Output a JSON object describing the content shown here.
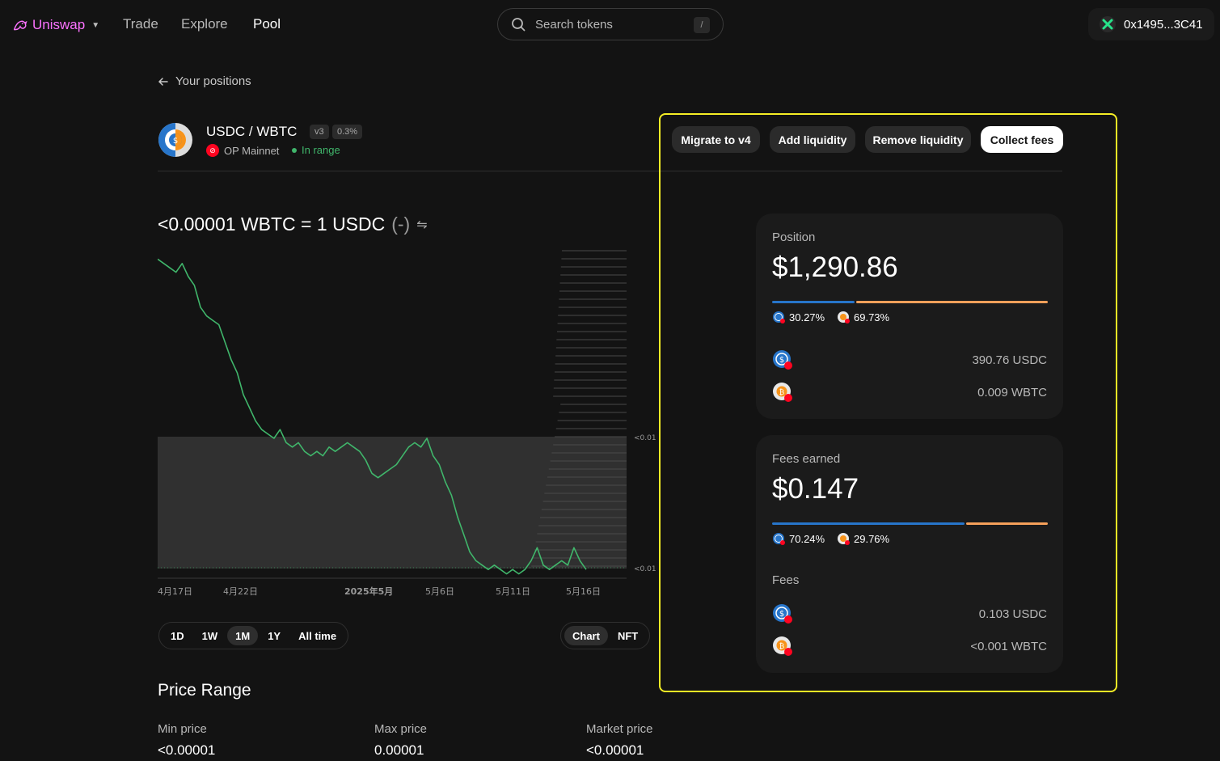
{
  "nav": {
    "brand": "Uniswap",
    "links": [
      "Trade",
      "Explore",
      "Pool"
    ],
    "search_placeholder": "Search tokens",
    "search_shortcut": "/",
    "wallet": "0x1495...3C41"
  },
  "header": {
    "back_label": "Your positions",
    "pair": "USDC / WBTC",
    "version": "v3",
    "fee": "0.3%",
    "network": "OP Mainnet",
    "status": "In range"
  },
  "actions": {
    "migrate": "Migrate to v4",
    "add": "Add liquidity",
    "remove": "Remove liquidity",
    "collect": "Collect fees"
  },
  "price": {
    "quote": "<0.00001 WBTC = 1 USDC",
    "change": "(-)"
  },
  "chart_data": {
    "type": "line",
    "x_labels": [
      "4月17日",
      "4月22日",
      "2025年5月",
      "5月6日",
      "5月11日",
      "5月16日"
    ],
    "right_axis_labels": [
      "<0.01",
      "<0.01"
    ],
    "range_band": "in-range",
    "series": [
      {
        "color": "#40b66b",
        "values": [
          8.1e-06,
          8e-06,
          7.9e-06,
          7.8e-06,
          8e-06,
          7.7e-06,
          7.5e-06,
          7e-06,
          6.8e-06,
          6.7e-06,
          6.6e-06,
          6.2e-06,
          5.8e-06,
          5.5e-06,
          5e-06,
          4.7e-06,
          4.4e-06,
          4.2e-06,
          4.1e-06,
          4e-06,
          4.2e-06,
          3.9e-06,
          3.8e-06,
          3.9e-06,
          3.7e-06,
          3.6e-06,
          3.7e-06,
          3.6e-06,
          3.8e-06,
          3.7e-06,
          3.8e-06,
          3.9e-06,
          3.8e-06,
          3.7e-06,
          3.5e-06,
          3.2e-06,
          3.1e-06,
          3.2e-06,
          3.3e-06,
          3.4e-06,
          3.6e-06,
          3.8e-06,
          3.9e-06,
          3.8e-06,
          4e-06,
          3.6e-06,
          3.4e-06,
          3e-06,
          2.7e-06,
          2.2e-06,
          1.8e-06,
          1.4e-06,
          1.2e-06,
          1.1e-06,
          1e-06,
          1.1e-06,
          1e-06,
          9e-07,
          1e-06,
          9e-07,
          1e-06,
          1.2e-06,
          1.5e-06,
          1.1e-06,
          1e-06,
          1.1e-06,
          1.2e-06,
          1.1e-06,
          1.5e-06,
          1.2e-06,
          1e-06
        ]
      }
    ],
    "time_ranges": [
      "1D",
      "1W",
      "1M",
      "1Y",
      "All time"
    ],
    "active_range": "1M",
    "views": [
      "Chart",
      "NFT"
    ],
    "active_view": "Chart"
  },
  "price_range": {
    "title": "Price Range",
    "min_label": "Min price",
    "min_value": "<0.00001",
    "max_label": "Max price",
    "max_value": "0.00001",
    "market_label": "Market price",
    "market_value": "<0.00001"
  },
  "position": {
    "label": "Position",
    "value": "$1,290.86",
    "usdc_pct": "30.27%",
    "wbtc_pct": "69.73%",
    "usdc_amount": "390.76 USDC",
    "wbtc_amount": "0.009 WBTC"
  },
  "fees": {
    "label": "Fees earned",
    "value": "$0.147",
    "usdc_pct": "70.24%",
    "wbtc_pct": "29.76%",
    "section_label": "Fees",
    "usdc_amount": "0.103 USDC",
    "wbtc_amount": "<0.001 WBTC"
  },
  "colors": {
    "accent": "#fc72ff",
    "usdc": "#2775ca",
    "wbtc": "#f5a05a",
    "green": "#40b66b",
    "highlight": "#f6ee25"
  }
}
